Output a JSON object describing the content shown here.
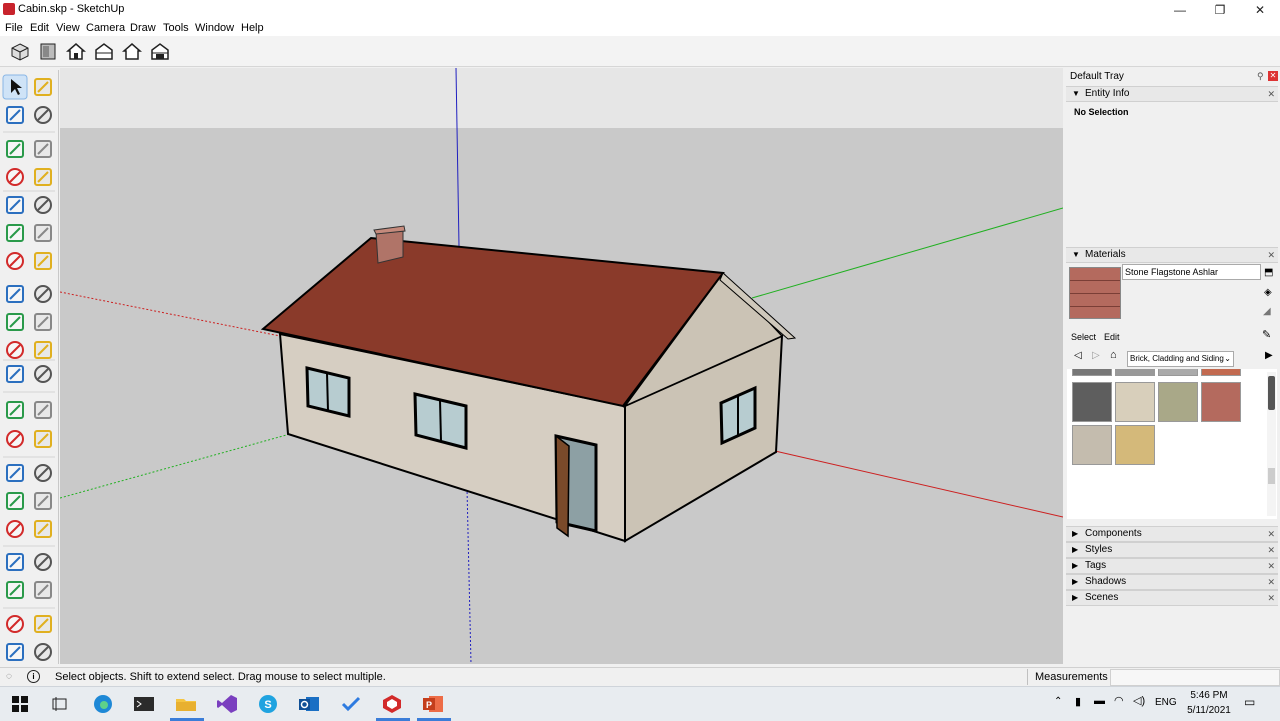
{
  "window": {
    "title": "Cabin.skp - SketchUp",
    "minimize_icon": "minimize-icon",
    "maximize_icon": "restore-icon",
    "close_icon": "close-icon"
  },
  "menu": [
    "File",
    "Edit",
    "View",
    "Camera",
    "Draw",
    "Tools",
    "Window",
    "Help"
  ],
  "toolbar": {
    "icons": [
      "iso-view-icon",
      "top-view-icon",
      "front-view-icon",
      "right-view-icon",
      "back-view-icon",
      "left-view-icon"
    ]
  },
  "palette": {
    "tools": [
      "select-icon",
      "make-component-icon",
      "paint-bucket-icon",
      "eraser-icon",
      "line-icon",
      "freehand-icon",
      "rectangle-icon",
      "rotated-rectangle-icon",
      "circle-icon",
      "polygon-icon",
      "arc-icon",
      "two-point-arc-icon",
      "three-point-arc-icon",
      "pie-icon",
      "move-icon",
      "push-pull-icon",
      "rotate-icon",
      "follow-me-icon",
      "scale-icon",
      "offset-icon",
      "tape-measure-icon",
      "dimension-icon",
      "protractor-icon",
      "text-icon",
      "axes-icon",
      "3d-text-icon",
      "orbit-icon",
      "pan-icon",
      "zoom-icon",
      "zoom-window-icon",
      "zoom-extents-icon",
      "previous-view-icon",
      "position-camera-icon",
      "look-around-icon",
      "walk-icon",
      "section-plane-icon",
      "3d-warehouse-icon",
      "extension-warehouse-icon",
      "layout-icon",
      "extension-manager-icon"
    ]
  },
  "tray": {
    "title": "Default Tray",
    "entity_info": {
      "header": "Entity Info",
      "selection": "No Selection"
    },
    "materials": {
      "header": "Materials",
      "current_name": "Stone Flagstone Ashlar",
      "tab_select": "Select",
      "tab_edit": "Edit",
      "collection": "Brick, Cladding and Siding",
      "swatch_colors": [
        "#5e5e5e",
        "#d8cfbb",
        "#a9a888",
        "#b46a5e",
        "#c4bcae",
        "#d4b97a"
      ]
    },
    "collapsed_panels": [
      "Components",
      "Styles",
      "Tags",
      "Shadows",
      "Scenes"
    ]
  },
  "status": {
    "hint": "Select objects. Shift to extend select. Drag mouse to select multiple.",
    "measurements_label": "Measurements",
    "measurements_value": ""
  },
  "taskbar": {
    "apps": [
      "task-view-icon",
      "edge-icon",
      "terminal-icon",
      "file-explorer-icon",
      "visual-studio-icon",
      "skype-icon",
      "outlook-icon",
      "todo-icon",
      "sketchup-icon",
      "powerpoint-icon"
    ],
    "language": "ENG",
    "time": "5:46 PM",
    "date": "5/11/2021"
  },
  "colors": {
    "roof": "#8a3a2a",
    "wall": "#d6cec2",
    "window": "#b7ccd0",
    "door": "#7a4a2a",
    "axis_red": "#cc2020",
    "axis_green": "#20b020",
    "axis_blue": "#2020c0",
    "sky": "#e6e6e6",
    "ground": "#c9c9c9"
  }
}
